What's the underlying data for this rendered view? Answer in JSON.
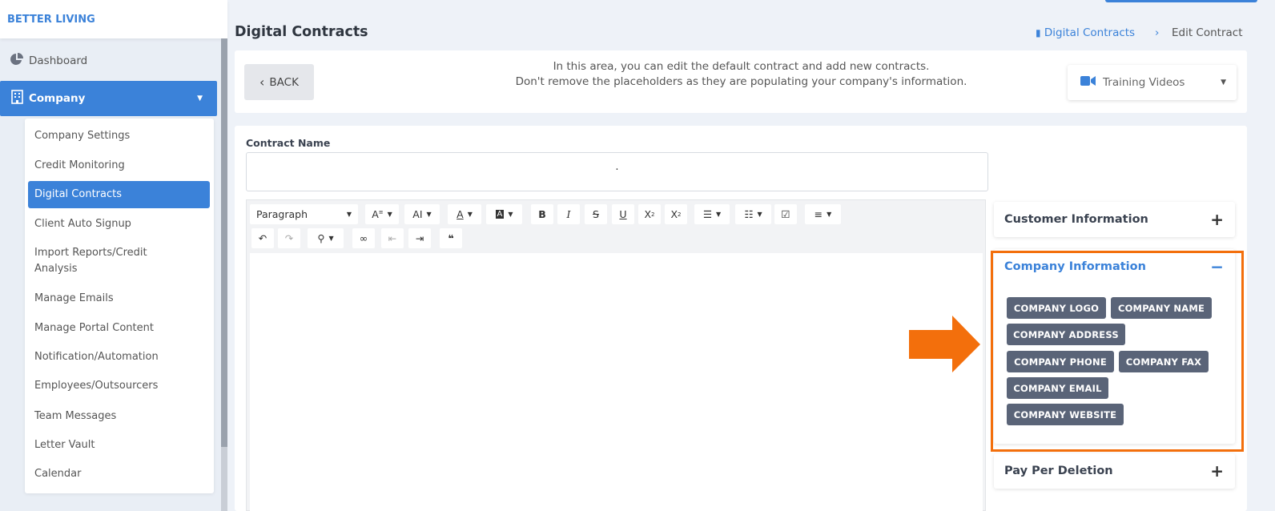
{
  "brand": "BETTER LIVING",
  "sidebar": {
    "dashboard": "Dashboard",
    "company": "Company",
    "submenu": [
      "Company Settings",
      "Credit Monitoring",
      "Digital Contracts",
      "Client Auto Signup",
      "Import Reports/Credit Analysis",
      "Manage Emails",
      "Manage Portal Content",
      "Notification/Automation",
      "Employees/Outsourcers",
      "Team Messages",
      "Letter Vault",
      "Calendar"
    ],
    "active_item": "Digital Contracts"
  },
  "header": {
    "title": "Digital Contracts",
    "breadcrumb_link": "Digital Contracts",
    "breadcrumb_current": "Edit Contract"
  },
  "infobar": {
    "back_label": "BACK",
    "info_line1": "In this area, you can edit the default contract and add new contracts.",
    "info_line2": "Don't remove the placeholders as they are populating your company's information.",
    "training_label": "Training Videos"
  },
  "form": {
    "contract_name_label": "Contract Name",
    "contract_name_value": "."
  },
  "editor": {
    "block_format": "Paragraph"
  },
  "panels": {
    "customer_info": "Customer Information",
    "company_info": "Company Information",
    "pay_per_deletion": "Pay Per Deletion",
    "company_tags": [
      "COMPANY LOGO",
      "COMPANY NAME",
      "COMPANY ADDRESS",
      "COMPANY PHONE",
      "COMPANY FAX",
      "COMPANY EMAIL",
      "COMPANY WEBSITE"
    ]
  },
  "colors": {
    "accent": "#3b82d9",
    "highlight": "#f36f0c",
    "tag_bg": "#5a6478"
  }
}
